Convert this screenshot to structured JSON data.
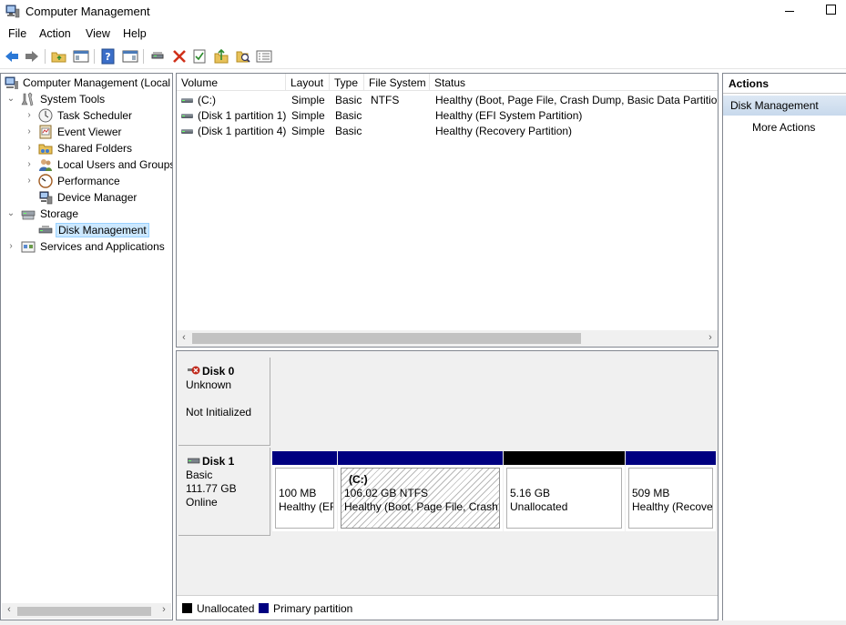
{
  "window": {
    "title": "Computer Management"
  },
  "menu": [
    "File",
    "Action",
    "View",
    "Help"
  ],
  "toolbar": [
    "back-icon",
    "forward-icon",
    "up-folder-icon",
    "show-hide-console-tree-icon",
    "help-icon",
    "show-hide-action-pane-icon",
    "connect-icon",
    "delete-icon",
    "properties-icon",
    "export-icon",
    "search-icon",
    "detail-view-icon"
  ],
  "tree": {
    "root": "Computer Management (Local",
    "system_tools": "System Tools",
    "task_scheduler": "Task Scheduler",
    "event_viewer": "Event Viewer",
    "shared_folders": "Shared Folders",
    "local_users": "Local Users and Groups",
    "performance": "Performance",
    "device_manager": "Device Manager",
    "storage": "Storage",
    "disk_management": "Disk Management",
    "services": "Services and Applications"
  },
  "volumes": {
    "columns": [
      "Volume",
      "Layout",
      "Type",
      "File System",
      "Status"
    ],
    "rows": [
      {
        "volume": "(C:)",
        "layout": "Simple",
        "type": "Basic",
        "fs": "NTFS",
        "status": "Healthy (Boot, Page File, Crash Dump, Basic Data Partition)"
      },
      {
        "volume": "(Disk 1 partition 1)",
        "layout": "Simple",
        "type": "Basic",
        "fs": "",
        "status": "Healthy (EFI System Partition)"
      },
      {
        "volume": "(Disk 1 partition 4)",
        "layout": "Simple",
        "type": "Basic",
        "fs": "",
        "status": "Healthy (Recovery Partition)"
      }
    ]
  },
  "disks": {
    "disk0": {
      "name": "Disk 0",
      "line1": "Unknown",
      "line2": "Not Initialized"
    },
    "disk1": {
      "name": "Disk 1",
      "line1": "Basic",
      "line2": "111.77 GB",
      "line3": "Online",
      "partitions": [
        {
          "label": "",
          "size": "100 MB",
          "status": "Healthy (EFI System Partition)",
          "color": "#000080"
        },
        {
          "label": "(C:)",
          "size": "106.02 GB NTFS",
          "status": "Healthy (Boot, Page File, Crash Dump, Basic Data Partition)",
          "color": "#000080"
        },
        {
          "label": "",
          "size": "5.16 GB",
          "status": "Unallocated",
          "color": "#000000"
        },
        {
          "label": "",
          "size": "509 MB",
          "status": "Healthy (Recovery Partition)",
          "color": "#000080"
        }
      ]
    }
  },
  "legend": [
    {
      "label": "Unallocated",
      "color": "#000000"
    },
    {
      "label": "Primary partition",
      "color": "#000080"
    }
  ],
  "actions": {
    "header": "Actions",
    "section": "Disk Management",
    "more": "More Actions"
  }
}
